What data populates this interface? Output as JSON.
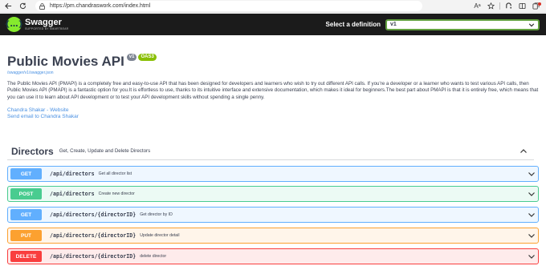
{
  "browser": {
    "url": "https://pm.chandraswork.com/index.html",
    "read_aloud_label": "Aᵃ"
  },
  "topbar": {
    "brand": "Swagger",
    "brand_sub": "Supported by SMARTBEAR",
    "definition_label": "Select a definition",
    "definition_value": "v1"
  },
  "info": {
    "title": "Public Movies API",
    "version_badge": "v1",
    "oas_badge": "OAS3",
    "spec_url": "/swagger/v1/swagger.json",
    "description": "The Public Movies API (PMAPI) is a completely free and easy-to-use API that has been designed for developers and learners who wish to try out different API calls. If you're a developer or a learner who wants to test various API calls, then Public Movies API (PMAPI) is a fantastic option for you.It is effortless to use, thanks to its intuitive interface and extensive documentation, which makes it ideal for beginners.The best part about PMAPI is that it is entirely free, which means that you can use it to learn about API development or to test your API development skills without spending a single penny.",
    "contact_website": "Chandra Shakar - Website",
    "contact_email": "Send email to Chandra Shakar"
  },
  "tag": {
    "name": "Directors",
    "description": "Get, Create, Update and Delete Directors"
  },
  "operations": [
    {
      "method": "GET",
      "path": "/api/directors",
      "summary": "Get all director list"
    },
    {
      "method": "POST",
      "path": "/api/directors",
      "summary": "Create new director"
    },
    {
      "method": "GET",
      "path": "/api/directors/{directorID}",
      "summary": "Get director by ID"
    },
    {
      "method": "PUT",
      "path": "/api/directors/{directorID}",
      "summary": "Update director detail"
    },
    {
      "method": "DELETE",
      "path": "/api/directors/{directorID}",
      "summary": "delete director"
    }
  ],
  "colors": {
    "get": "#61affe",
    "post": "#49cc90",
    "put": "#fca130",
    "delete": "#f93e3e",
    "topbar": "#1b1b1b",
    "brand_green": "#85ea2d",
    "link": "#4990e2"
  },
  "icons": {
    "back": "arrow-left-icon",
    "refresh": "refresh-icon",
    "lock": "lock-icon",
    "favorite": "star-icon",
    "extensions": "copilot-icon",
    "split": "split-screen-icon",
    "collections": "collections-icon",
    "collapse": "chevron-up-icon",
    "expand": "chevron-down-icon"
  }
}
